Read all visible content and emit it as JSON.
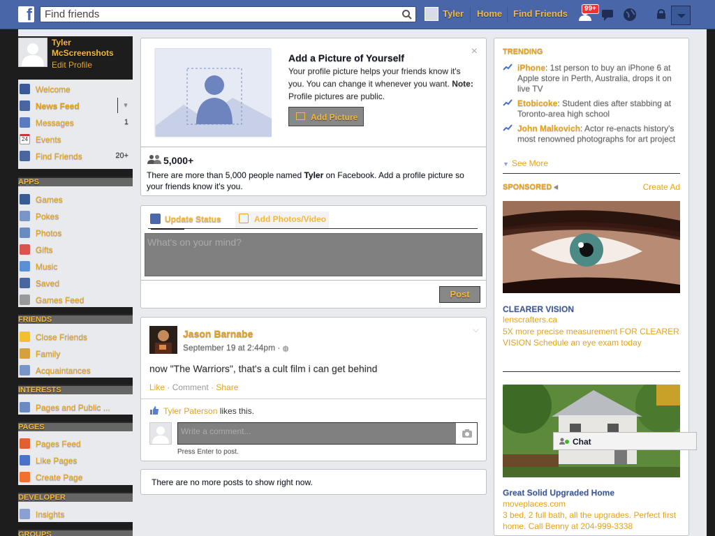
{
  "topbar": {
    "logo": "f",
    "search_placeholder": "Find friends",
    "user_name": "Tyler",
    "home": "Home",
    "find_friends": "Find Friends",
    "notif_count": "99+"
  },
  "sidebar": {
    "profile_name": "Tyler McScreenshots",
    "edit_profile": "Edit Profile",
    "favorites": [
      {
        "label": "Welcome",
        "count": ""
      },
      {
        "label": "News Feed",
        "count": ""
      },
      {
        "label": "Messages",
        "count": "1"
      },
      {
        "label": "Events",
        "count": ""
      },
      {
        "label": "Find Friends",
        "count": "20+"
      }
    ],
    "apps_header": "APPS",
    "apps": [
      "Games",
      "Pokes",
      "Photos",
      "Gifts",
      "Music",
      "Saved",
      "Games Feed"
    ],
    "friends_header": "FRIENDS",
    "friends": [
      "Close Friends",
      "Family",
      "Acquaintances"
    ],
    "interests_header": "INTERESTS",
    "interests": [
      "Pages and Public ..."
    ],
    "pages_header": "PAGES",
    "pages": [
      "Pages Feed",
      "Like Pages",
      "Create Page"
    ],
    "developer_header": "DEVELOPER",
    "developer": [
      "Insights"
    ],
    "groups_header": "GROUPS",
    "events_day": "24"
  },
  "profile_prompt": {
    "title": "Add a Picture of Yourself",
    "text": "Your profile picture helps your friends know it's you. You can change it whenever you want.",
    "note_label": "Note:",
    "note_text": " Profile pictures are public.",
    "button": "Add Picture",
    "close": "×",
    "people_count": "5,000+",
    "people_text_1": "There are more than 5,000 people named ",
    "people_name": "Tyler",
    "people_text_2": " on Facebook. Add a profile picture so your friends know it's you."
  },
  "composer": {
    "tab_status": "Update Status",
    "tab_photo": "Add Photos/Video",
    "placeholder": "What's on your mind?",
    "post_button": "Post"
  },
  "post": {
    "author": "Jason Barnabe",
    "date": "September 19 at 2:44pm",
    "date_sep": " · ",
    "text": "now \"The Warriors\", that's a cult film i can get behind",
    "like": "Like",
    "comment": "Comment",
    "share": "Share",
    "liker": "Tyler Paterson",
    "likes_suffix": " likes this.",
    "comment_placeholder": "Write a comment...",
    "press_enter": "Press Enter to post."
  },
  "no_more": "There are no more posts to show right now.",
  "right": {
    "trending_header": "TRENDING",
    "trending": [
      {
        "keyword": "iPhone",
        "text": ": 1st person to buy an iPhone 6 at Apple store in Perth, Australia, drops it on live TV"
      },
      {
        "keyword": "Etobicoke",
        "text": ": Student dies after stabbing at Toronto-area high school"
      },
      {
        "keyword": "John Malkovich",
        "text": ": Actor re-enacts history's most renowned photographs for art project"
      }
    ],
    "see_more": "See More",
    "sponsored_header": "SPONSORED",
    "create_ad": "Create Ad",
    "ads": [
      {
        "title": "CLEARER VISION",
        "domain": "lenscrafters.ca",
        "text": "5X more precise measurement FOR CLEARER VISION Schedule an eye exam today"
      },
      {
        "title": "Great Solid Upgraded Home",
        "domain": "moveplaces.com",
        "text": "3 bed, 2 full bath, all the upgrades. Perfect first home. Call Benny at 204-999-3338"
      }
    ]
  },
  "chat": {
    "label": "Chat"
  }
}
